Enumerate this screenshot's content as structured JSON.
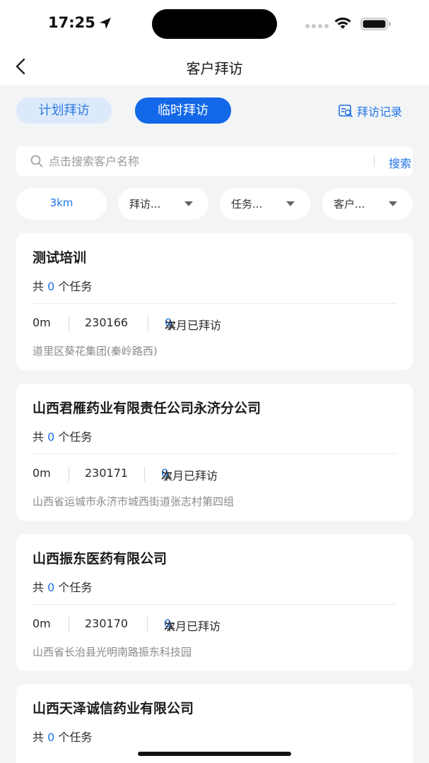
{
  "status_bar": {
    "time": "17:25"
  },
  "nav": {
    "title": "客户拜访"
  },
  "tabs": {
    "plan": "计划拜访",
    "temp": "临时拜访",
    "record": "拜访记录"
  },
  "search": {
    "placeholder": "点击搜索客户名称",
    "value": "",
    "button": "搜索"
  },
  "filters": {
    "distance": "3km",
    "visit": "拜访...",
    "task": "任务...",
    "customer": "客户..."
  },
  "labels": {
    "total_prefix": "共",
    "task_suffix": "个任务",
    "visited_prefix": "本月已拜访",
    "visited_suffix": "次"
  },
  "customers": [
    {
      "name": "测试培训",
      "tasks": "0",
      "distance": "0m",
      "code": "230166",
      "visits": "0",
      "address": "道里区葵花集团(秦岭路西)"
    },
    {
      "name": "山西君雁药业有限责任公司永济分公司",
      "tasks": "0",
      "distance": "0m",
      "code": "230171",
      "visits": "0",
      "address": "山西省运城市永济市城西街道张志村第四组"
    },
    {
      "name": "山西振东医药有限公司",
      "tasks": "0",
      "distance": "0m",
      "code": "230170",
      "visits": "0",
      "address": "山西省长治县光明南路振东科技园"
    },
    {
      "name": "山西天泽诚信药业有限公司",
      "tasks": "0"
    }
  ]
}
